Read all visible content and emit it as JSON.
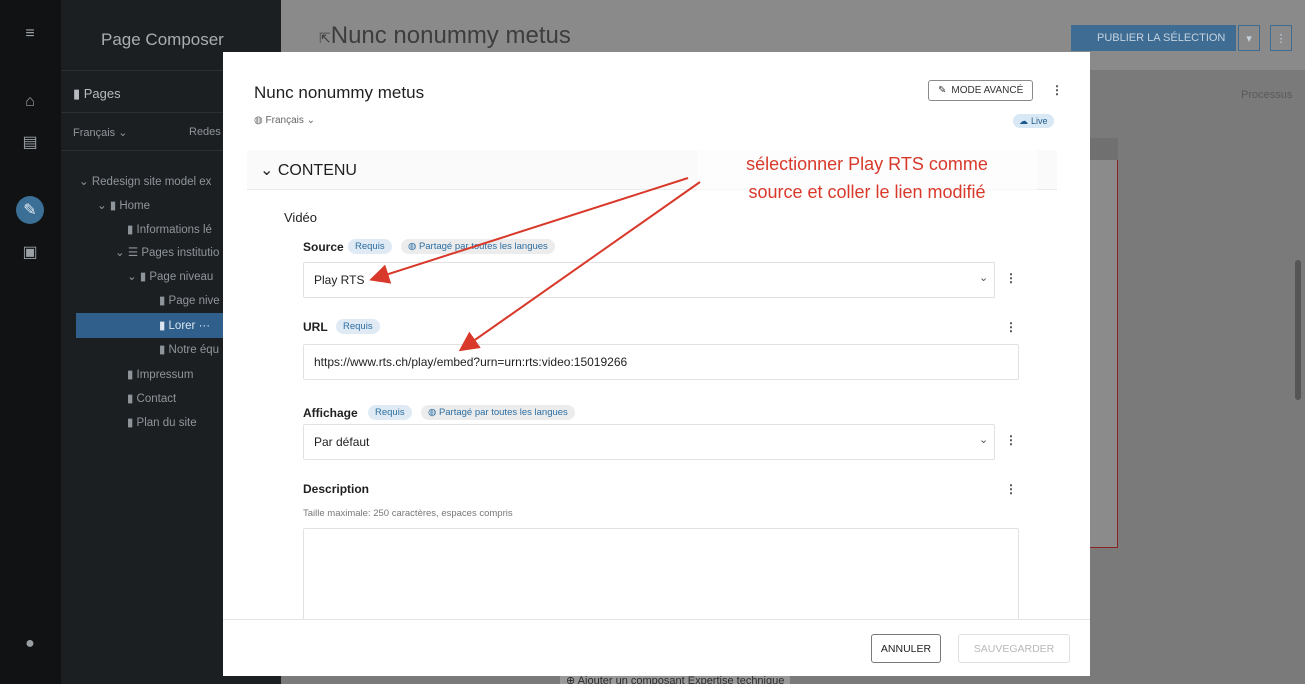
{
  "rail": {
    "icons": [
      "menu-icon",
      "home-icon",
      "clipboard-icon",
      "edit-icon",
      "image-icon",
      "user-icon"
    ]
  },
  "tree": {
    "title": "Page Composer",
    "pages_label": "Pages",
    "language": "Français",
    "site_prefix": "Redes",
    "nodes": [
      "Redesign site model ex",
      "Home",
      "Informations lé",
      "Pages institutio",
      "Page niveau",
      "Page nive",
      "Lorer",
      "Notre équ",
      "Impressum",
      "Contact",
      "Plan du site"
    ],
    "selected_more": "···"
  },
  "header": {
    "title": "Nunc nonummy metus",
    "publish_label": "PUBLIER LA SÉLECTION",
    "more": "⋮",
    "processus": "Processus",
    "add_component": "Ajouter un composant Expertise technique"
  },
  "modal": {
    "title": "Nunc nonummy metus",
    "language": "Français",
    "advanced_mode": "MODE AVANCÉ",
    "status": "Live",
    "section": "CONTENU",
    "group": "Vidéo",
    "source": {
      "label": "Source",
      "required": "Requis",
      "shared": "Partagé par toutes les langues",
      "value": "Play RTS"
    },
    "url": {
      "label": "URL",
      "required": "Requis",
      "value": "https://www.rts.ch/play/embed?urn=urn:rts:video:15019266"
    },
    "display": {
      "label": "Affichage",
      "required": "Requis",
      "shared": "Partagé par toutes les langues",
      "value": "Par défaut"
    },
    "description": {
      "label": "Description",
      "help": "Taille maximale: 250 caractères, espaces compris",
      "value": ""
    },
    "cancel": "ANNULER",
    "save": "SAUVEGARDER"
  },
  "annotation": {
    "line1": "sélectionner Play RTS comme",
    "line2": "source et coller le lien modifié",
    "color": "#d8392a"
  }
}
